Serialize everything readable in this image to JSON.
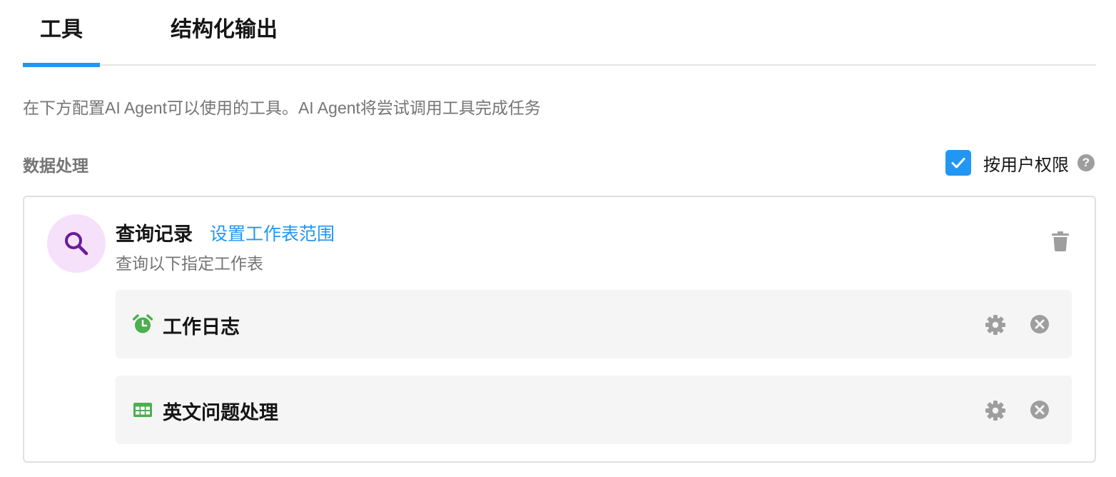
{
  "tabs": [
    {
      "label": "工具",
      "active": true
    },
    {
      "label": "结构化输出",
      "active": false
    }
  ],
  "description": "在下方配置AI Agent可以使用的工具。AI Agent将尝试调用工具完成任务",
  "section": {
    "title": "数据处理",
    "permission_label": "按用户权限",
    "permission_checked": true
  },
  "tool": {
    "icon": "search-icon",
    "title": "查询记录",
    "link": "设置工作表范围",
    "subtitle": "查询以下指定工作表",
    "sheets": [
      {
        "name": "工作日志",
        "icon": "alarm-clock-icon",
        "color": "#4caf50"
      },
      {
        "name": "英文问题处理",
        "icon": "table-grid-icon",
        "color": "#4caf50"
      }
    ]
  },
  "colors": {
    "accent": "#2196f3",
    "search_icon": "#6a1b9a",
    "search_bg": "#f6e1fb",
    "muted_icon": "#9e9e9e"
  }
}
